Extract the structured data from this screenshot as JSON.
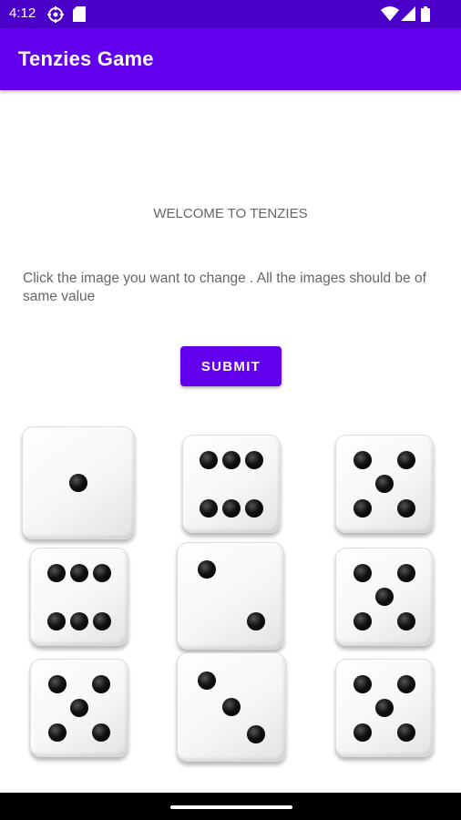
{
  "status_bar": {
    "time": "4:12",
    "icons": [
      "vpn-settings-icon",
      "sim-card-icon",
      "wifi-icon",
      "signal-icon",
      "battery-icon"
    ]
  },
  "app_bar": {
    "title": "Tenzies Game",
    "color": "#6200ee"
  },
  "main": {
    "welcome": "WELCOME TO TENZIES",
    "instruction": "Click the image you want to change . All the images should be of same value",
    "submit_label": "SUBMIT"
  },
  "dice": [
    1,
    6,
    5,
    6,
    2,
    5,
    5,
    3,
    5
  ]
}
